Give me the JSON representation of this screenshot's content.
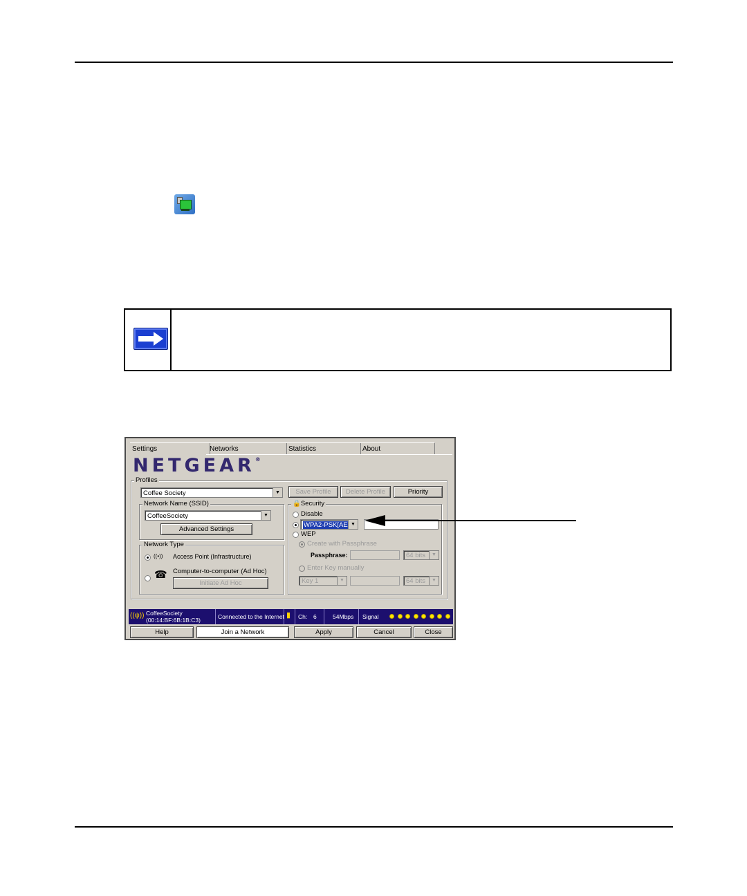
{
  "window": {
    "tabs": [
      "Settings",
      "Networks",
      "Statistics",
      "About"
    ],
    "logo": "NETGEAR",
    "logo_mark": "®",
    "profiles": {
      "legend": "Profiles",
      "selected": "Coffee Society",
      "save_label": "Save Profile",
      "delete_label": "Delete Profile",
      "priority_label": "Priority"
    },
    "network_name": {
      "legend": "Network Name (SSID)",
      "value": "CoffeeSociety",
      "advanced_label": "Advanced Settings"
    },
    "network_type": {
      "legend": "Network Type",
      "infrastructure_label": "Access Point (Infrastructure)",
      "adhoc_label": "Computer-to-computer (Ad Hoc)",
      "initiate_label": "Initiate Ad Hoc"
    },
    "security": {
      "legend": "Security",
      "disable_label": "Disable",
      "wpa_value": "WPA2-PSK[AES]",
      "wep_label": "WEP",
      "create_pass_label": "Create with Passphrase",
      "passphrase_label": "Passphrase:",
      "bits_1": "64 bits",
      "enter_key_label": "Enter Key manually",
      "key_value": "Key 1",
      "bits_2": "64 bits"
    },
    "status": {
      "ssid": "CoffeeSociety",
      "mac": "(00:14:BF:6B:1B:C3)",
      "connection": "Connected to the Internet",
      "channel_label": "Ch:",
      "channel": "6",
      "rate": "54Mbps",
      "signal_label": "Signal",
      "signal_level": 8
    },
    "buttons": {
      "help": "Help",
      "join": "Join a Network",
      "apply": "Apply",
      "cancel": "Cancel",
      "close": "Close"
    }
  },
  "colors": {
    "logo": "#33286e",
    "status_bar": "#1c0f6e",
    "note_arrow": "#1b3fd1",
    "signal_dot": "#ffe800"
  }
}
